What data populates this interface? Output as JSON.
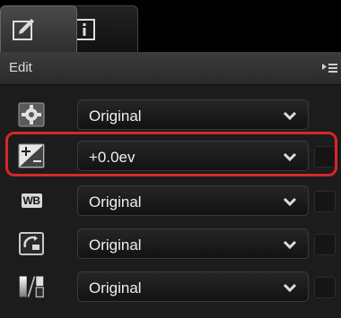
{
  "tabs": [
    {
      "name": "edit-tab",
      "icon": "edit-icon",
      "active": true
    },
    {
      "name": "info-tab",
      "icon": "info-icon",
      "active": false
    }
  ],
  "header": {
    "title": "Edit",
    "menu_icon": "panel-menu-icon"
  },
  "rows": [
    {
      "icon": "gear-icon",
      "value": "Original"
    },
    {
      "icon": "exposure-compensation-icon",
      "value": "+0.0ev",
      "highlighted": true
    },
    {
      "icon": "white-balance-icon",
      "icon_text": "WB",
      "value": "Original"
    },
    {
      "icon": "picture-control-icon",
      "value": "Original"
    },
    {
      "icon": "tone-curve-icon",
      "value": "Original"
    }
  ],
  "colors": {
    "highlight": "#d8262a",
    "background": "#1c1c1c"
  }
}
